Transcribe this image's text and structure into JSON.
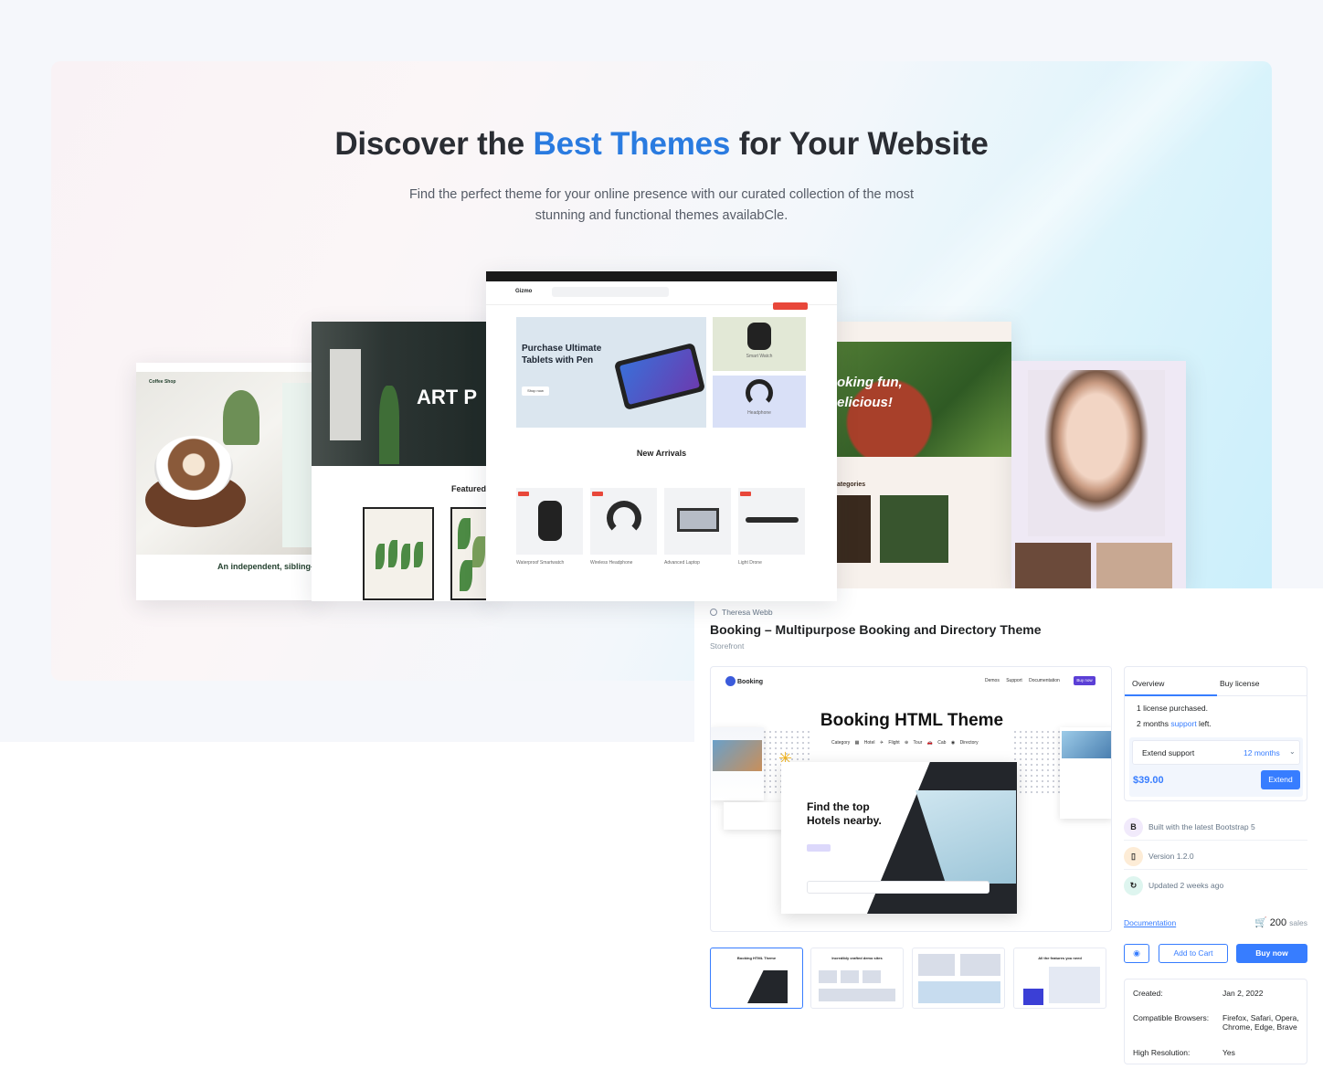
{
  "hero": {
    "title_pre": "Discover the ",
    "title_accent": "Best Themes",
    "title_post": " for Your Website",
    "subtitle_line1": "Find the perfect theme for your online presence with our curated collection of the most",
    "subtitle_line2": "stunning and functional themes availabCle.",
    "accent_color": "#2a7be0"
  },
  "showcase": {
    "coffee": {
      "brand": "Coffee Shop",
      "headline": "An independent, sibling-"
    },
    "art": {
      "headline": "ART P",
      "section": "Featured"
    },
    "gizmo": {
      "logo": "Gizmo",
      "banner_title": "Purchase Ultimate Tablets with Pen",
      "banner_button": "Shop now",
      "watch_label": "Smart Watch",
      "headphone_label": "Headphone",
      "section_title": "New Arrivals",
      "sale_badge": "Sale",
      "products": [
        "Waterproof Smartwatch",
        "Wireless Headphone",
        "Advanced Laptop",
        "Light Drone"
      ]
    },
    "cooking": {
      "headline_1": "oking fun,",
      "headline_2": "elicious!",
      "section": "ategories"
    },
    "beauty": {}
  },
  "product": {
    "author": "Theresa Webb",
    "title": "Booking – Multipurpose Booking and Directory Theme",
    "category": "Storefront",
    "preview": {
      "logo": "Booking",
      "menu": "Demos Support Documentation",
      "buy_btn": "Buy now",
      "headline": "Booking HTML Theme",
      "categories": "Category ▦ Hotel ✈ Flight ⊕ Tour 🚗 Cab ◉ Directory",
      "hero_text_1": "Find the top",
      "hero_text_2": "Hotels nearby."
    },
    "thumbnails": [
      {
        "title": "Booking HTML Theme"
      },
      {
        "title": "Incredibly crafted demo sites"
      },
      {
        "title": ""
      },
      {
        "title": "All the features you need"
      }
    ]
  },
  "license": {
    "tab_overview": "Overview",
    "tab_buy": "Buy license",
    "purchased": "1 license purchased.",
    "support_pre": "2 months ",
    "support_link": "support",
    "support_post": " left.",
    "extend_label": "Extend support",
    "extend_value": "12 months",
    "price": "$39.00",
    "extend_button": "Extend"
  },
  "features": [
    {
      "text": "Built with the latest Bootstrap 5",
      "icon": "bootstrap-icon",
      "glyph": "B"
    },
    {
      "text": "Version 1.2.0",
      "icon": "version-icon",
      "glyph": "▯"
    },
    {
      "text": "Updated 2 weeks ago",
      "icon": "update-icon",
      "glyph": "↻"
    }
  ],
  "actions": {
    "documentation": "Documentation",
    "sales_count": "200",
    "sales_label": "sales",
    "add_to_cart": "Add to Cart",
    "buy_now": "Buy now"
  },
  "meta": {
    "created_label": "Created:",
    "created_value": "Jan 2, 2022",
    "browsers_label": "Compatible Browsers:",
    "browsers_value": "Firefox, Safari, Opera, Chrome, Edge, Brave",
    "hires_label": "High Resolution:",
    "hires_value": "Yes"
  },
  "colors": {
    "primary": "#377dff",
    "text": "#1e2022",
    "muted": "#677788"
  }
}
